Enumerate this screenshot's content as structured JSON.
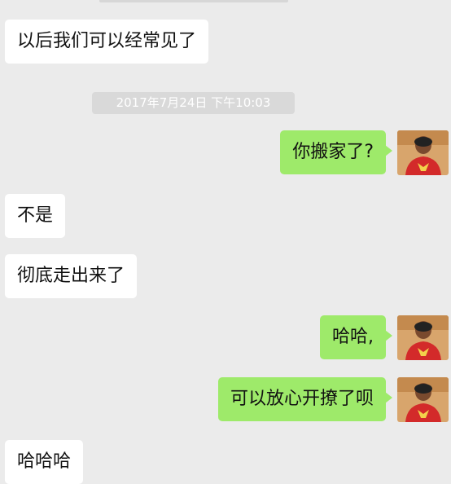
{
  "chat": {
    "messages": [
      {
        "side": "left",
        "text": "以后我们可以经常见了"
      },
      {
        "side": "time",
        "text": "2017年7月24日 下午10:03"
      },
      {
        "side": "right",
        "text": "你搬家了?"
      },
      {
        "side": "left",
        "text": "不是"
      },
      {
        "side": "left",
        "text": "彻底走出来了"
      },
      {
        "side": "right",
        "text": "哈哈,"
      },
      {
        "side": "right",
        "text": "可以放心开撩了呗"
      },
      {
        "side": "left",
        "text": "哈哈哈"
      }
    ]
  },
  "colors": {
    "background": "#ebebeb",
    "incoming_bubble": "#ffffff",
    "outgoing_bubble": "#9eea6a",
    "timestamp_pill": "#d9d9d9"
  },
  "icons": {
    "avatar": "user-avatar-photo"
  }
}
